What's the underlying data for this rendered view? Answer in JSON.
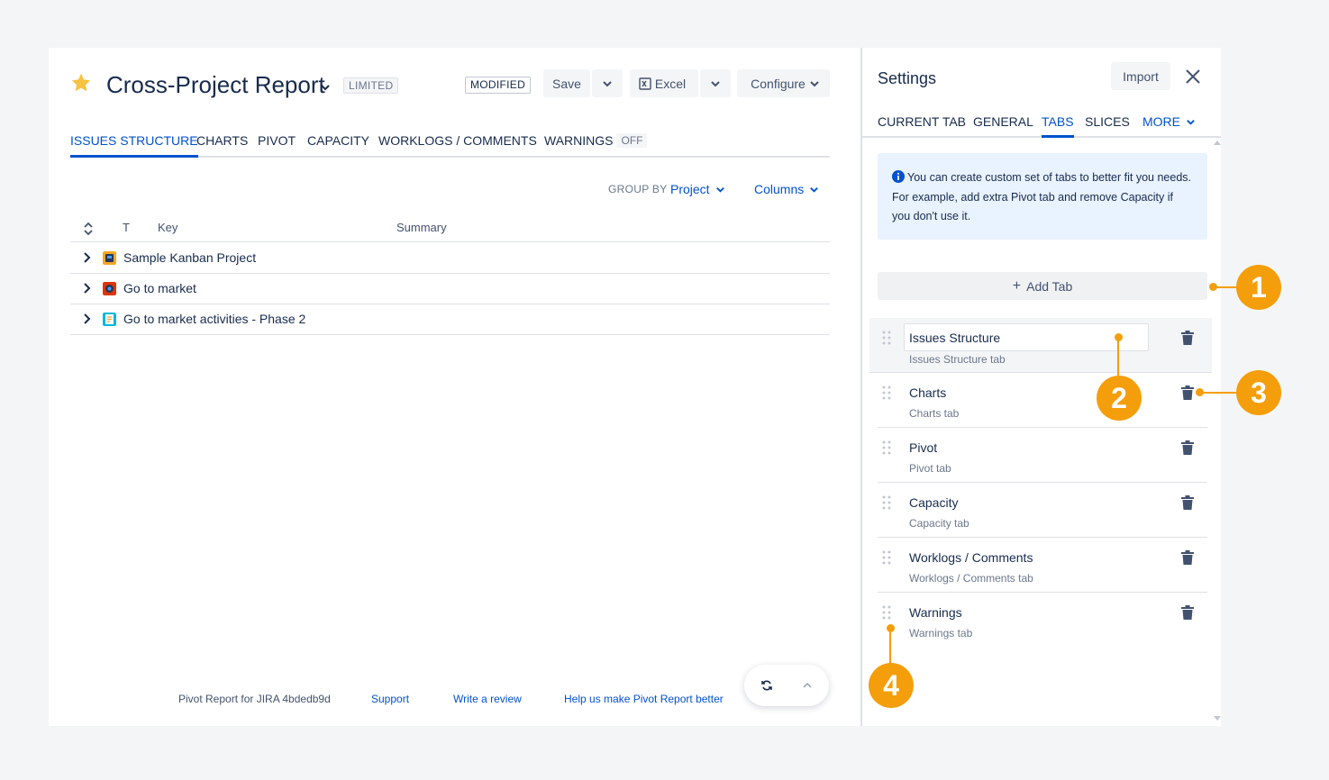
{
  "report": {
    "title": "Cross-Project Report",
    "badge_limited": "LIMITED",
    "badge_modified": "MODIFIED"
  },
  "toolbar": {
    "save_label": "Save",
    "excel_label": "Excel",
    "configure_label": "Configure"
  },
  "tabs": [
    {
      "label": "ISSUES STRUCTURE",
      "active": true
    },
    {
      "label": "CHARTS"
    },
    {
      "label": "PIVOT"
    },
    {
      "label": "CAPACITY"
    },
    {
      "label": "WORKLOGS / COMMENTS"
    },
    {
      "label": "WARNINGS",
      "badge": "OFF"
    }
  ],
  "groupby": {
    "label": "GROUP BY",
    "value": "Project",
    "columns_label": "Columns"
  },
  "table": {
    "headers": {
      "t": "T",
      "key": "Key",
      "summary": "Summary"
    },
    "rows": [
      {
        "text": "Sample Kanban Project",
        "icon": "kanban-project-icon",
        "icon_color": "#f5a623"
      },
      {
        "text": "Go to market",
        "icon": "project-icon",
        "icon_color": "#de350b"
      },
      {
        "text": "Go to market activities - Phase 2",
        "icon": "notepad-project-icon",
        "icon_color": "#00b8d9"
      }
    ]
  },
  "footer": {
    "version": "Pivot Report for JIRA 4bdedb9d",
    "support": "Support",
    "review": "Write a review",
    "help": "Help us make Pivot Report better"
  },
  "settings": {
    "title": "Settings",
    "import_label": "Import",
    "tabs": [
      {
        "label": "CURRENT TAB"
      },
      {
        "label": "GENERAL"
      },
      {
        "label": "TABS",
        "active": true
      },
      {
        "label": "SLICES"
      },
      {
        "label": "MORE"
      }
    ],
    "info_text": "You can create custom set of tabs to better fit you needs. For example, add extra Pivot tab and remove Capacity if you don't use it.",
    "add_tab_label": "Add Tab",
    "tab_items": [
      {
        "name": "Issues Structure",
        "sub": "Issues Structure tab"
      },
      {
        "name": "Charts",
        "sub": "Charts tab"
      },
      {
        "name": "Pivot",
        "sub": "Pivot tab"
      },
      {
        "name": "Capacity",
        "sub": "Capacity tab"
      },
      {
        "name": "Worklogs / Comments",
        "sub": "Worklogs / Comments tab"
      },
      {
        "name": "Warnings",
        "sub": "Warnings tab"
      }
    ]
  },
  "callouts": [
    "1",
    "2",
    "3",
    "4"
  ],
  "colors": {
    "accent": "#0052cc",
    "star": "#f6c342",
    "callout": "#f59e0b",
    "info_bg": "#e9f2ff"
  }
}
